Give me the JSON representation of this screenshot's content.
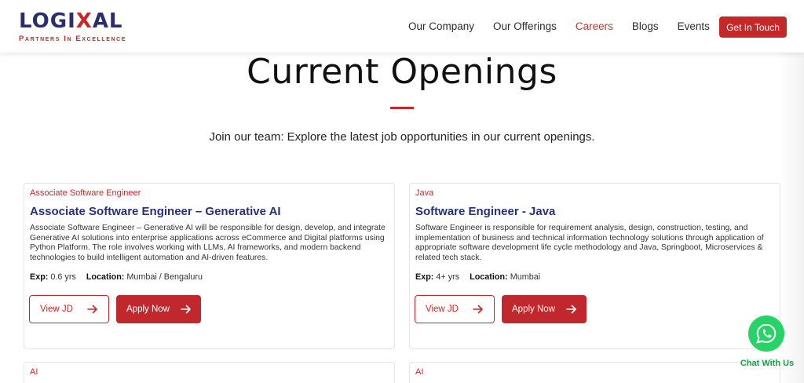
{
  "header": {
    "logo": {
      "text_before_x": "LOGI",
      "text_x": "X",
      "text_after_x": "AL",
      "tagline": "Partners In Excellence"
    },
    "nav": [
      {
        "label": "Our Company",
        "active": false
      },
      {
        "label": "Our Offerings",
        "active": false
      },
      {
        "label": "Careers",
        "active": true
      },
      {
        "label": "Blogs",
        "active": false
      },
      {
        "label": "Events",
        "active": false
      }
    ],
    "cta_label": "Get In Touch"
  },
  "hero": {
    "title": "Current Openings",
    "subtitle": "Join our team: Explore the latest job opportunities in our current openings."
  },
  "jobs": [
    {
      "category": "Associate Software Engineer",
      "title": "Associate Software Engineer – Generative AI",
      "description": "Associate Software Engineer – Generative AI will be responsible for design, develop, and integrate Generative AI solutions into enterprise applications across eCommerce and Digital platforms using Python Platform. The role involves working with LLMs, AI frameworks, and modern backend technologies to build intelligent automation and AI-driven features.",
      "exp_label": "Exp:",
      "exp_value": "0.6 yrs",
      "location_label": "Location:",
      "location_value": "Mumbai / Bengaluru",
      "view_label": "View JD",
      "apply_label": "Apply Now"
    },
    {
      "category": "Java",
      "title": "Software Engineer - Java",
      "description": "Software Engineer is responsible for requirement analysis, design, construction, testing, and implementation of business and technical information technology solutions through application of appropriate software development life cycle methodology and Java, Springboot, Microservices & related tech stack.",
      "exp_label": "Exp:",
      "exp_value": "4+ yrs",
      "location_label": "Location:",
      "location_value": "Mumbai",
      "view_label": "View JD",
      "apply_label": "Apply Now"
    },
    {
      "category": "AI"
    },
    {
      "category": "AI"
    }
  ],
  "chat": {
    "label": "Chat With Us"
  },
  "colors": {
    "brand_red": "#c62828",
    "brand_navy": "#25307a",
    "whatsapp_green": "#25d366"
  }
}
